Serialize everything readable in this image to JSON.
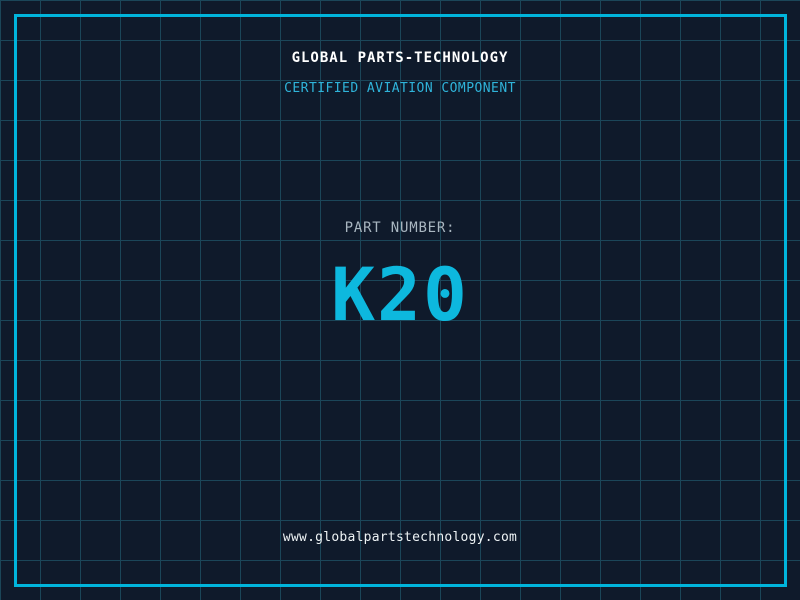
{
  "header": {
    "title": "GLOBAL PARTS-TECHNOLOGY",
    "subtitle": "CERTIFIED AVIATION COMPONENT"
  },
  "part": {
    "label": "PART NUMBER:",
    "value": "K20"
  },
  "footer": {
    "url": "www.globalpartstechnology.com"
  },
  "colors": {
    "background": "#0f1a2b",
    "grid_line": "#1b4659",
    "border_frame": "#00b4dc",
    "title_text": "#ffffff",
    "subtitle_text": "#2fb4da",
    "label_text": "#a9b6c0",
    "part_number_text": "#0db8de",
    "url_text": "#eef3f5"
  },
  "layout_meta": {
    "grid_cell_px": "40"
  }
}
